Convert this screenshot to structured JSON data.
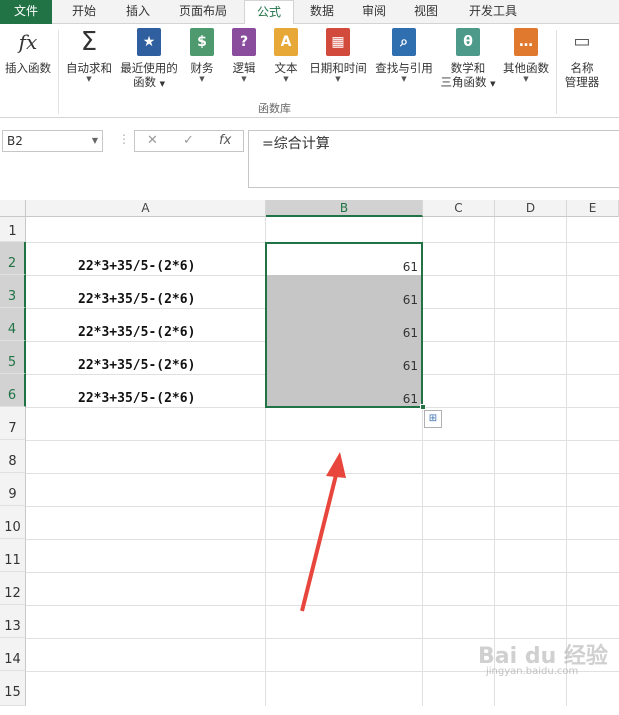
{
  "tabs": [
    {
      "label": "文件"
    },
    {
      "label": "开始"
    },
    {
      "label": "插入"
    },
    {
      "label": "页面布局"
    },
    {
      "label": "公式"
    },
    {
      "label": "数据"
    },
    {
      "label": "审阅"
    },
    {
      "label": "视图"
    },
    {
      "label": "开发工具"
    }
  ],
  "ribbon": {
    "insert_function": {
      "label": "插入函数",
      "icon": "fx-icon"
    },
    "autosum": {
      "label": "自动求和",
      "icon": "sigma-icon"
    },
    "recent": {
      "label_line1": "最近使用的",
      "label_line2": "函数",
      "icon": "star-book-icon"
    },
    "financial": {
      "label": "财务",
      "icon": "coins-book-icon"
    },
    "logical": {
      "label": "逻辑",
      "icon": "question-book-icon"
    },
    "text": {
      "label": "文本",
      "icon": "text-book-icon"
    },
    "datetime": {
      "label": "日期和时间",
      "icon": "calendar-book-icon"
    },
    "lookup": {
      "label": "查找与引用",
      "icon": "magnifier-book-icon"
    },
    "math": {
      "label_line1": "数学和",
      "label_line2": "三角函数",
      "icon": "theta-book-icon"
    },
    "more": {
      "label": "其他函数",
      "icon": "more-book-icon"
    },
    "name_manager": {
      "label_line1": "名称",
      "label_line2": "管理器",
      "icon": "name-tags-icon"
    },
    "group_label": "函数库"
  },
  "formula_bar": {
    "name_box": "B2",
    "formula": "=综合计算",
    "cancel_glyph": "✕",
    "enter_glyph": "✓",
    "fx_glyph": "fx"
  },
  "sheet": {
    "columns": [
      "A",
      "B",
      "C",
      "D",
      "E"
    ],
    "rows": [
      "1",
      "2",
      "3",
      "4",
      "5",
      "6",
      "7",
      "8",
      "9",
      "10",
      "11",
      "12",
      "13",
      "14",
      "15"
    ],
    "col_a_values": [
      "22*3+35/5-(2*6)",
      "22*3+35/5-(2*6)",
      "22*3+35/5-(2*6)",
      "22*3+35/5-(2*6)",
      "22*3+35/5-(2*6)"
    ],
    "col_b_values": [
      "61",
      "61",
      "61",
      "61",
      "61"
    ],
    "selected_column": "B"
  },
  "watermark": {
    "text": "Bai du 经验",
    "sub": "jingyan.baidu.com"
  },
  "colors": {
    "accent": "#217346",
    "arrow": "#e8453c"
  }
}
